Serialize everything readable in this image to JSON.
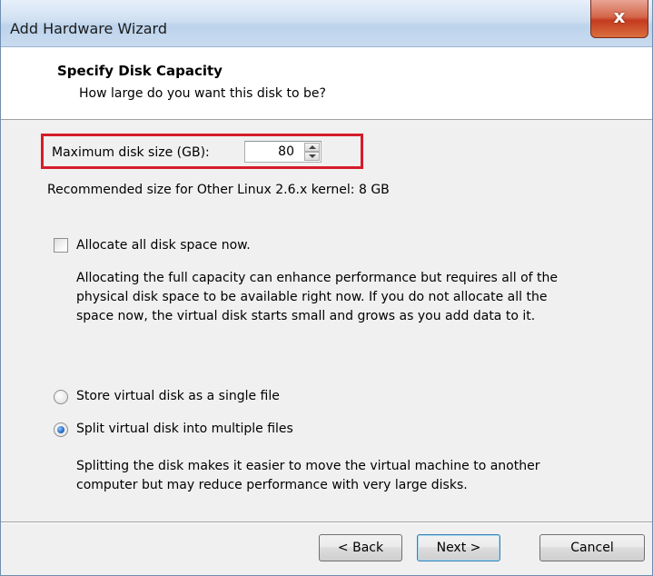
{
  "window": {
    "title": "Add Hardware Wizard",
    "close_symbol": "x"
  },
  "header": {
    "title": "Specify Disk Capacity",
    "subtitle": "How large do you want this disk to be?"
  },
  "disk_size": {
    "label": "Maximum disk size (GB):",
    "value": "80",
    "highlight_color": "#d51c2a"
  },
  "recommended_text": "Recommended size for Other Linux 2.6.x kernel: 8 GB",
  "allocate": {
    "label": "Allocate all disk space now.",
    "checked": false,
    "description_lines": [
      "Allocating the full capacity can enhance performance but requires all of the",
      "physical disk space to be available right now. If you do not allocate all the",
      "space now, the virtual disk starts small and grows as you add data to it."
    ]
  },
  "storage_options": {
    "single_file_label": "Store virtual disk as a single file",
    "multiple_files_label": "Split virtual disk into multiple files",
    "selected": "multiple_files",
    "split_description_lines": [
      "Splitting the disk makes it easier to move the virtual machine to another",
      "computer but may reduce performance with very large disks."
    ]
  },
  "buttons": {
    "back": "< Back",
    "next": "Next >",
    "cancel": "Cancel"
  }
}
